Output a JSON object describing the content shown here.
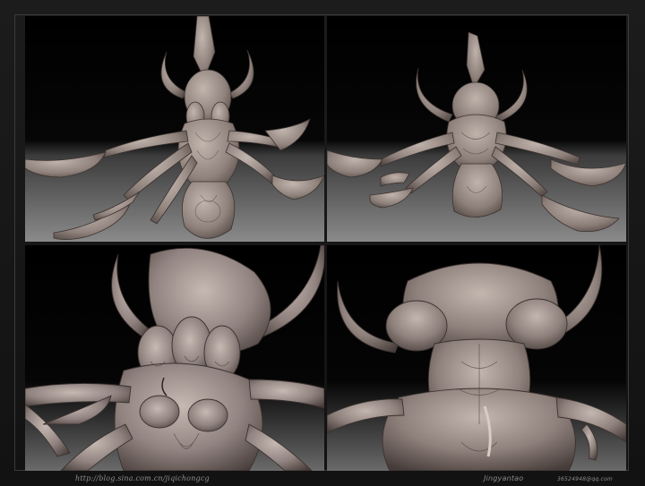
{
  "footer": {
    "url": "http://blog.sina.com.cn/jiqichongcg",
    "author": "Jingyantao",
    "email": "36524948@qq.com"
  },
  "colors": {
    "background": "#161616",
    "sculpt_clay": "#9d8f89",
    "sculpt_shadow": "#4a403c",
    "panel_top": "#000000",
    "panel_floor": "#7f7f7f"
  },
  "panels": [
    {
      "view": "front-full-body"
    },
    {
      "view": "back-full-body"
    },
    {
      "view": "front-close-up"
    },
    {
      "view": "back-close-up"
    }
  ]
}
